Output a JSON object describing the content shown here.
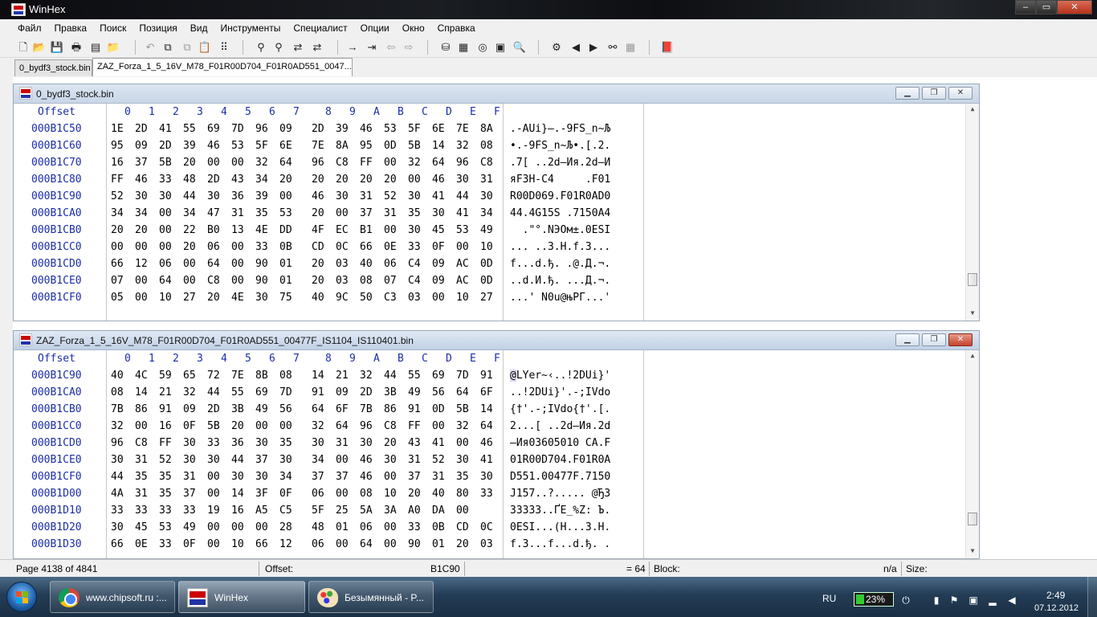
{
  "window": {
    "title": "WinHex",
    "controls": [
      "‒",
      "▭",
      "✕"
    ]
  },
  "menu": [
    "Файл",
    "Правка",
    "Поиск",
    "Позиция",
    "Вид",
    "Инструменты",
    "Специалист",
    "Опции",
    "Окно",
    "Справка"
  ],
  "toolbar": {
    "icons": [
      "new-file-icon",
      "open-file-icon",
      "save-icon",
      "print-icon",
      "properties-icon",
      "open-folder-icon",
      "undo-icon",
      "cut-icon",
      "copy-icon",
      "paste-icon",
      "write-icon",
      "convert-icon",
      "find-text-icon",
      "find-hex-icon",
      "replace-text-icon",
      "replace-hex-icon",
      "goto-offset-icon",
      "goto-sector-icon",
      "back-icon",
      "forward-icon",
      "disk-icon",
      "ram-icon",
      "cd-icon",
      "calculator-icon",
      "search-icon",
      "compare-icon",
      "arrow-left-icon",
      "arrow-right-icon",
      "binoculars-icon",
      "grid-icon",
      "book-icon"
    ]
  },
  "tabs": [
    "0_bydf3_stock.bin",
    "ZAZ_Forza_1_5_16V_M78_F01R00D704_F01R0AD551_0047..."
  ],
  "header": {
    "offset": "Offset",
    "cols": [
      "0",
      "1",
      "2",
      "3",
      "4",
      "5",
      "6",
      "7",
      "8",
      "9",
      "A",
      "B",
      "C",
      "D",
      "E",
      "F"
    ]
  },
  "windows": [
    {
      "title": "0_bydf3_stock.bin",
      "rows": [
        {
          "offset": "000B1C50",
          "bytes": [
            "1E",
            "2D",
            "41",
            "55",
            "69",
            "7D",
            "96",
            "09",
            "2D",
            "39",
            "46",
            "53",
            "5F",
            "6E",
            "7E",
            "8A"
          ],
          "ascii": ".-AUi}–.-9FS_n~Љ"
        },
        {
          "offset": "000B1C60",
          "bytes": [
            "95",
            "09",
            "2D",
            "39",
            "46",
            "53",
            "5F",
            "6E",
            "7E",
            "8A",
            "95",
            "0D",
            "5B",
            "14",
            "32",
            "08"
          ],
          "ascii": "•.-9FS_n~Љ•.[.2."
        },
        {
          "offset": "000B1C70",
          "bytes": [
            "16",
            "37",
            "5B",
            "20",
            "00",
            "00",
            "32",
            "64",
            "96",
            "C8",
            "FF",
            "00",
            "32",
            "64",
            "96",
            "C8"
          ],
          "ascii": ".7[ ..2d–Ия.2d–И"
        },
        {
          "offset": "000B1C80",
          "bytes": [
            "FF",
            "46",
            "33",
            "48",
            "2D",
            "43",
            "34",
            "20",
            "20",
            "20",
            "20",
            "20",
            "00",
            "46",
            "30",
            "31"
          ],
          "ascii": "яF3H-C4     .F01"
        },
        {
          "offset": "000B1C90",
          "bytes": [
            "52",
            "30",
            "30",
            "44",
            "30",
            "36",
            "39",
            "00",
            "46",
            "30",
            "31",
            "52",
            "30",
            "41",
            "44",
            "30"
          ],
          "ascii": "R00D069.F01R0AD0"
        },
        {
          "offset": "000B1CA0",
          "bytes": [
            "34",
            "34",
            "00",
            "34",
            "47",
            "31",
            "35",
            "53",
            "20",
            "00",
            "37",
            "31",
            "35",
            "30",
            "41",
            "34"
          ],
          "ascii": "44.4G15S .7150A4"
        },
        {
          "offset": "000B1CB0",
          "bytes": [
            "20",
            "20",
            "00",
            "22",
            "B0",
            "13",
            "4E",
            "DD",
            "4F",
            "EC",
            "B1",
            "00",
            "30",
            "45",
            "53",
            "49"
          ],
          "ascii": "  .\"°.NЭOм±.0ESI"
        },
        {
          "offset": "000B1CC0",
          "bytes": [
            "00",
            "00",
            "00",
            "20",
            "06",
            "00",
            "33",
            "0B",
            "CD",
            "0C",
            "66",
            "0E",
            "33",
            "0F",
            "00",
            "10"
          ],
          "ascii": "... ..3.Н.f.3..."
        },
        {
          "offset": "000B1CD0",
          "bytes": [
            "66",
            "12",
            "06",
            "00",
            "64",
            "00",
            "90",
            "01",
            "20",
            "03",
            "40",
            "06",
            "C4",
            "09",
            "AC",
            "0D"
          ],
          "ascii": "f...d.ђ. .@.Д.¬."
        },
        {
          "offset": "000B1CE0",
          "bytes": [
            "07",
            "00",
            "64",
            "00",
            "C8",
            "00",
            "90",
            "01",
            "20",
            "03",
            "08",
            "07",
            "C4",
            "09",
            "AC",
            "0D"
          ],
          "ascii": "..d.И.ђ. ...Д.¬."
        },
        {
          "offset": "000B1CF0",
          "bytes": [
            "05",
            "00",
            "10",
            "27",
            "20",
            "4E",
            "30",
            "75",
            "40",
            "9C",
            "50",
            "C3",
            "03",
            "00",
            "10",
            "27"
          ],
          "ascii": "...' N0u@њPГ...'"
        }
      ]
    },
    {
      "title": "ZAZ_Forza_1_5_16V_M78_F01R00D704_F01R0AD551_00477F_IS1104_IS110401.bin",
      "rows": [
        {
          "offset": "000B1C90",
          "bytes": [
            "40",
            "4C",
            "59",
            "65",
            "72",
            "7E",
            "8B",
            "08",
            "14",
            "21",
            "32",
            "44",
            "55",
            "69",
            "7D",
            "91"
          ],
          "ascii": "@LYer~‹..!2DUi}'"
        },
        {
          "offset": "000B1CA0",
          "bytes": [
            "08",
            "14",
            "21",
            "32",
            "44",
            "55",
            "69",
            "7D",
            "91",
            "09",
            "2D",
            "3B",
            "49",
            "56",
            "64",
            "6F"
          ],
          "ascii": "..!2DUi}'.-;IVdo"
        },
        {
          "offset": "000B1CB0",
          "bytes": [
            "7B",
            "86",
            "91",
            "09",
            "2D",
            "3B",
            "49",
            "56",
            "64",
            "6F",
            "7B",
            "86",
            "91",
            "0D",
            "5B",
            "14"
          ],
          "ascii": "{†'.-;IVdo{†'.[."
        },
        {
          "offset": "000B1CC0",
          "bytes": [
            "32",
            "00",
            "16",
            "0F",
            "5B",
            "20",
            "00",
            "00",
            "32",
            "64",
            "96",
            "C8",
            "FF",
            "00",
            "32",
            "64"
          ],
          "ascii": "2...[ ..2d–Ия.2d"
        },
        {
          "offset": "000B1CD0",
          "bytes": [
            "96",
            "C8",
            "FF",
            "30",
            "33",
            "36",
            "30",
            "35",
            "30",
            "31",
            "30",
            "20",
            "43",
            "41",
            "00",
            "46"
          ],
          "ascii": "–Ия03605010 CA.F"
        },
        {
          "offset": "000B1CE0",
          "bytes": [
            "30",
            "31",
            "52",
            "30",
            "30",
            "44",
            "37",
            "30",
            "34",
            "00",
            "46",
            "30",
            "31",
            "52",
            "30",
            "41"
          ],
          "ascii": "01R00D704.F01R0A"
        },
        {
          "offset": "000B1CF0",
          "bytes": [
            "44",
            "35",
            "35",
            "31",
            "00",
            "30",
            "30",
            "34",
            "37",
            "37",
            "46",
            "00",
            "37",
            "31",
            "35",
            "30"
          ],
          "ascii": "D551.00477F.7150"
        },
        {
          "offset": "000B1D00",
          "bytes": [
            "4A",
            "31",
            "35",
            "37",
            "00",
            "14",
            "3F",
            "0F",
            "06",
            "00",
            "08",
            "10",
            "20",
            "40",
            "80",
            "33"
          ],
          "ascii": "J157..?..... @Ђ3"
        },
        {
          "offset": "000B1D10",
          "bytes": [
            "33",
            "33",
            "33",
            "33",
            "19",
            "16",
            "A5",
            "C5",
            "5F",
            "25",
            "5A",
            "3A",
            "A0",
            "DA",
            "00"
          ],
          "ascii": "33333..ҐЕ_%Z: Ъ."
        },
        {
          "offset": "000B1D20",
          "bytes": [
            "30",
            "45",
            "53",
            "49",
            "00",
            "00",
            "00",
            "28",
            "48",
            "01",
            "06",
            "00",
            "33",
            "0B",
            "CD",
            "0C"
          ],
          "ascii": "0ESI...(H...3.Н."
        },
        {
          "offset": "000B1D30",
          "bytes": [
            "66",
            "0E",
            "33",
            "0F",
            "00",
            "10",
            "66",
            "12",
            "06",
            "00",
            "64",
            "00",
            "90",
            "01",
            "20",
            "03"
          ],
          "ascii": "f.3...f...d.ђ. ."
        }
      ]
    }
  ],
  "status": {
    "page": "Page 4138 of 4841",
    "offset_label": "Offset:",
    "offset_value": "B1C90",
    "value": "= 64",
    "block_label": "Block:",
    "block_value": "n/a",
    "size_label": "Size:"
  },
  "taskbar": {
    "tasks": [
      "www.chipsoft.ru :...",
      "WinHex",
      "Безымянный - P..."
    ],
    "lang": "RU",
    "battery": "23%",
    "time": "2:49",
    "date": "07.12.2012"
  }
}
